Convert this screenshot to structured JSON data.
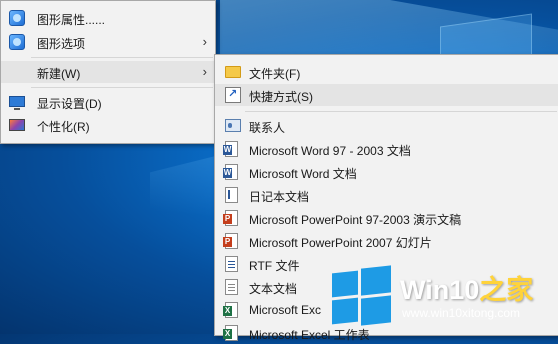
{
  "context_menu": {
    "items": [
      {
        "label": "图形属性......",
        "icon": "graphics-icon"
      },
      {
        "label": "图形选项",
        "icon": "graphics-icon",
        "has_submenu": true,
        "arrow": "›"
      },
      {
        "label": "新建(W)",
        "has_submenu": true,
        "arrow": "›",
        "highlighted": true
      },
      {
        "label": "显示设置(D)",
        "icon": "display-icon"
      },
      {
        "label": "个性化(R)",
        "icon": "personalize-icon"
      }
    ]
  },
  "new_submenu": {
    "items": [
      {
        "label": "文件夹(F)",
        "icon": "folder-icon"
      },
      {
        "label": "快捷方式(S)",
        "icon": "shortcut-icon",
        "highlighted": true
      },
      {
        "label": "联系人",
        "icon": "contact-icon"
      },
      {
        "label": "Microsoft Word 97 - 2003 文档",
        "icon": "word-doc-icon"
      },
      {
        "label": "Microsoft Word 文档",
        "icon": "word-doc-icon"
      },
      {
        "label": "日记本文档",
        "icon": "journal-icon"
      },
      {
        "label": "Microsoft PowerPoint 97-2003 演示文稿",
        "icon": "ppt-icon"
      },
      {
        "label": "Microsoft PowerPoint 2007 幻灯片",
        "icon": "ppt-icon"
      },
      {
        "label": "RTF 文件",
        "icon": "rtf-icon"
      },
      {
        "label": "文本文档",
        "icon": "text-doc-icon"
      },
      {
        "label": "Microsoft Exc",
        "icon": "excel-icon"
      },
      {
        "label": "Microsoft Excel 工作表",
        "icon": "excel-icon"
      }
    ]
  },
  "watermark": {
    "title_main": "Win10",
    "title_accent": "之家",
    "url": "www.win10xitong.com",
    "logo": "windows-logo-icon",
    "accent_color": "#ffd33a",
    "logo_color": "#1e9be5"
  }
}
